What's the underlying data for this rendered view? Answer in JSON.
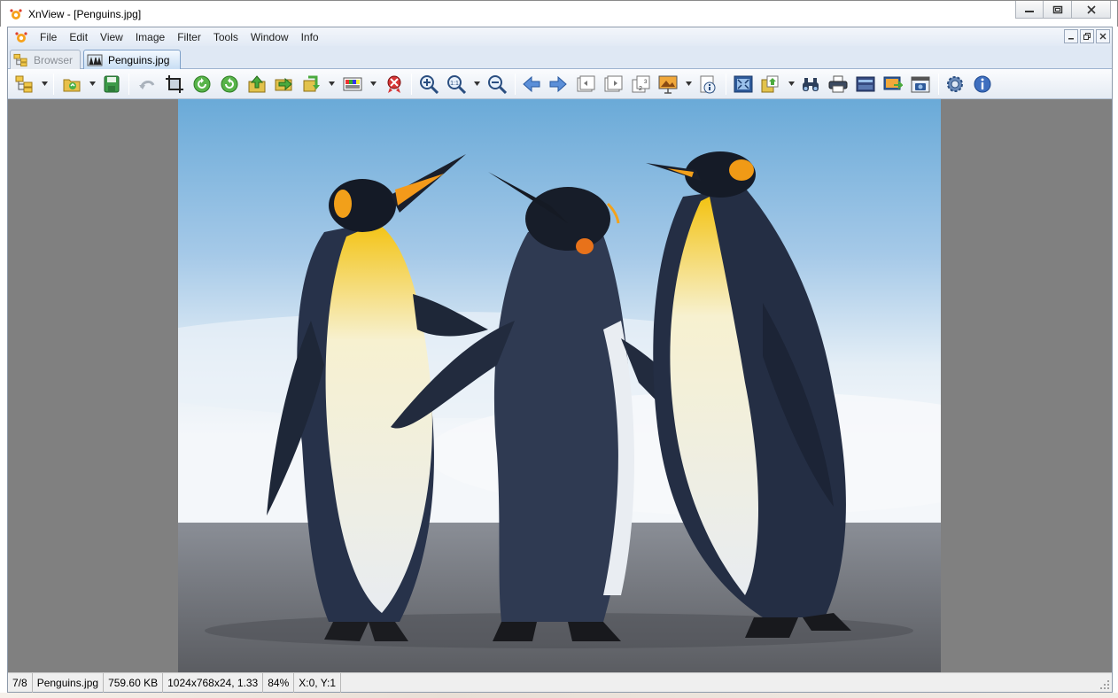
{
  "window": {
    "title": "XnView - [Penguins.jpg]"
  },
  "menu": {
    "items": [
      "File",
      "Edit",
      "View",
      "Image",
      "Filter",
      "Tools",
      "Window",
      "Info"
    ]
  },
  "tabs": [
    {
      "label": "Browser",
      "active": false
    },
    {
      "label": "Penguins.jpg",
      "active": true
    }
  ],
  "toolbar": {
    "icons": [
      "browser-tree-icon",
      "open-folder-icon",
      "save-icon",
      "undo-icon",
      "crop-icon",
      "rotate-left-icon",
      "rotate-right-icon",
      "move-up-icon",
      "move-right-icon",
      "convert-icon",
      "adjust-colors-icon",
      "delete-icon",
      "zoom-in-icon",
      "zoom-actual-icon",
      "zoom-out-icon",
      "previous-icon",
      "next-icon",
      "first-page-icon",
      "last-page-icon",
      "page-number-icon",
      "slideshow-icon",
      "properties-icon",
      "fullscreen-icon",
      "export-icon",
      "find-icon",
      "print-icon",
      "scanner-icon",
      "set-wallpaper-icon",
      "capture-icon",
      "settings-icon",
      "info-icon"
    ]
  },
  "status": {
    "index": "7/8",
    "filename": "Penguins.jpg",
    "filesize": "759.60 KB",
    "dimensions": "1024x768x24, 1.33",
    "zoom": "84%",
    "coords": "X:0, Y:1"
  },
  "colors": {
    "accent": "#3a6fb0",
    "viewer_background": "#808080"
  }
}
